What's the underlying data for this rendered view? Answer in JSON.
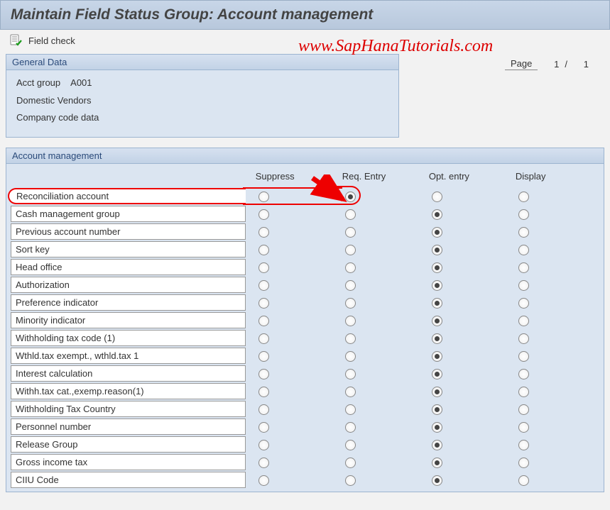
{
  "title": "Maintain Field Status Group: Account management",
  "toolbar": {
    "field_check": "Field check"
  },
  "watermark": "www.SapHanaTutorials.com",
  "general": {
    "header": "General Data",
    "acct_group_label": "Acct group",
    "acct_group_value": "A001",
    "line2": "Domestic Vendors",
    "line3": "Company code data"
  },
  "page": {
    "label": "Page",
    "current": "1",
    "sep": "/",
    "total": "1"
  },
  "am": {
    "header": "Account management",
    "columns": {
      "suppress": "Suppress",
      "req": "Req. Entry",
      "opt": "Opt. entry",
      "display": "Display"
    },
    "rows": [
      {
        "label": "Reconciliation account",
        "sel": "req",
        "highlight": true
      },
      {
        "label": "Cash management group",
        "sel": "opt"
      },
      {
        "label": "Previous account number",
        "sel": "opt"
      },
      {
        "label": "Sort key",
        "sel": "opt"
      },
      {
        "label": "Head office",
        "sel": "opt"
      },
      {
        "label": "Authorization",
        "sel": "opt"
      },
      {
        "label": "Preference indicator",
        "sel": "opt"
      },
      {
        "label": "Minority indicator",
        "sel": "opt"
      },
      {
        "label": "Withholding tax code (1)",
        "sel": "opt"
      },
      {
        "label": "Wthld.tax exempt., wthld.tax 1",
        "sel": "opt"
      },
      {
        "label": "Interest calculation",
        "sel": "opt"
      },
      {
        "label": "Withh.tax cat.,exemp.reason(1)",
        "sel": "opt"
      },
      {
        "label": "Withholding Tax Country",
        "sel": "opt"
      },
      {
        "label": "Personnel number",
        "sel": "opt"
      },
      {
        "label": "Release Group",
        "sel": "opt"
      },
      {
        "label": "Gross income tax",
        "sel": "opt"
      },
      {
        "label": "CIIU Code",
        "sel": "opt"
      }
    ]
  }
}
